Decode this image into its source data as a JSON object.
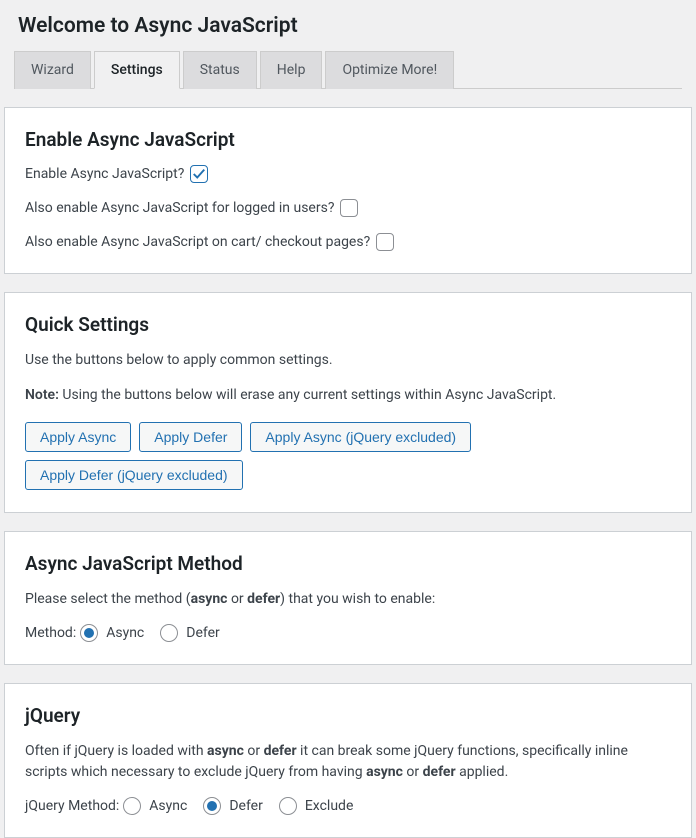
{
  "page_title": "Welcome to Async JavaScript",
  "tabs": {
    "wizard": "Wizard",
    "settings": "Settings",
    "status": "Status",
    "help": "Help",
    "optimize": "Optimize More!"
  },
  "enable_panel": {
    "heading": "Enable Async JavaScript",
    "enable_label": "Enable Async JavaScript?",
    "logged_in_label": "Also enable Async JavaScript for logged in users?",
    "cart_label": "Also enable Async JavaScript on cart/ checkout pages?"
  },
  "quick_panel": {
    "heading": "Quick Settings",
    "desc": "Use the buttons below to apply common settings.",
    "note_prefix": "Note:",
    "note_text": " Using the buttons below will erase any current settings within Async JavaScript.",
    "btn_async": "Apply Async",
    "btn_defer": "Apply Defer",
    "btn_async_jq": "Apply Async (jQuery excluded)",
    "btn_defer_jq": "Apply Defer (jQuery excluded)"
  },
  "method_panel": {
    "heading": "Async JavaScript Method",
    "desc_pre": "Please select the method (",
    "desc_async": "async",
    "desc_or": " or ",
    "desc_defer": "defer",
    "desc_post": ") that you wish to enable:",
    "method_label": "Method:",
    "async": "Async",
    "defer": "Defer"
  },
  "jquery_panel": {
    "heading": "jQuery",
    "d1": "Often if jQuery is loaded with ",
    "d2": "async",
    "d3": " or ",
    "d4": "defer",
    "d5": " it can break some jQuery functions, specifically inline scripts which necessary to exclude jQuery from having ",
    "d6": "async",
    "d7": " or ",
    "d8": "defer",
    "d9": " applied.",
    "method_label": "jQuery Method:",
    "async": "Async",
    "defer": "Defer",
    "exclude": "Exclude"
  }
}
